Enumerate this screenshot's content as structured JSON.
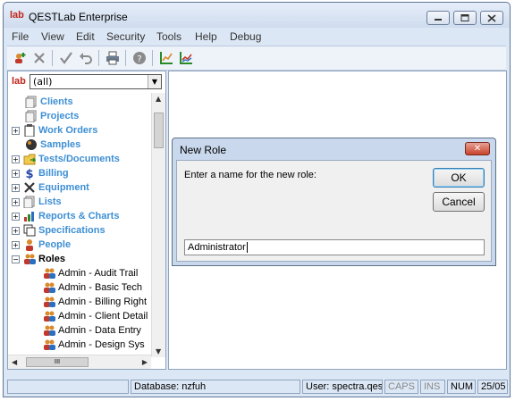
{
  "window": {
    "title": "QESTLab Enterprise",
    "logo_text": "lab"
  },
  "menu": [
    "File",
    "View",
    "Edit",
    "Security",
    "Tools",
    "Help",
    "Debug"
  ],
  "toolbar": {
    "icons": [
      "add-user-icon",
      "delete-icon",
      "check-icon",
      "undo-icon",
      "print-icon",
      "help-icon",
      "chart-icon",
      "chart-compare-icon"
    ]
  },
  "filter": {
    "logo_text": "lab",
    "value": "(all)"
  },
  "tree": {
    "top_items": [
      {
        "label": "Clients",
        "icon": "documents-icon",
        "expandable": false
      },
      {
        "label": "Projects",
        "icon": "documents-icon",
        "expandable": false
      },
      {
        "label": "Work Orders",
        "icon": "clipboard-icon",
        "expandable": true
      },
      {
        "label": "Samples",
        "icon": "samples-icon",
        "expandable": false
      },
      {
        "label": "Tests/Documents",
        "icon": "folder-icon",
        "expandable": true
      },
      {
        "label": "Billing",
        "icon": "dollar-icon",
        "expandable": true
      },
      {
        "label": "Equipment",
        "icon": "tools-icon",
        "expandable": true
      },
      {
        "label": "Lists",
        "icon": "documents-icon",
        "expandable": true
      },
      {
        "label": "Reports & Charts",
        "icon": "chart-icon",
        "expandable": true
      },
      {
        "label": "Specifications",
        "icon": "spec-icon",
        "expandable": true
      },
      {
        "label": "People",
        "icon": "person-icon",
        "expandable": true
      },
      {
        "label": "Roles",
        "icon": "people-icon",
        "expandable": true,
        "expanded": true
      }
    ],
    "role_children": [
      "Admin - Audit Trail",
      "Admin - Basic Tech",
      "Admin - Billing Right",
      "Admin - Client Detail",
      "Admin - Data Entry",
      "Admin - Design Sys"
    ],
    "hscroll_thumb": "III"
  },
  "dialog": {
    "title": "New Role",
    "prompt": "Enter a name for the new role:",
    "ok_label": "OK",
    "cancel_label": "Cancel",
    "input_value": "Administrator",
    "close_glyph": "✕"
  },
  "status": {
    "database": "Database: nzfuh",
    "user": "User: spectra.qest",
    "caps": "CAPS",
    "ins": "INS",
    "num": "NUM",
    "date": "25/05"
  }
}
